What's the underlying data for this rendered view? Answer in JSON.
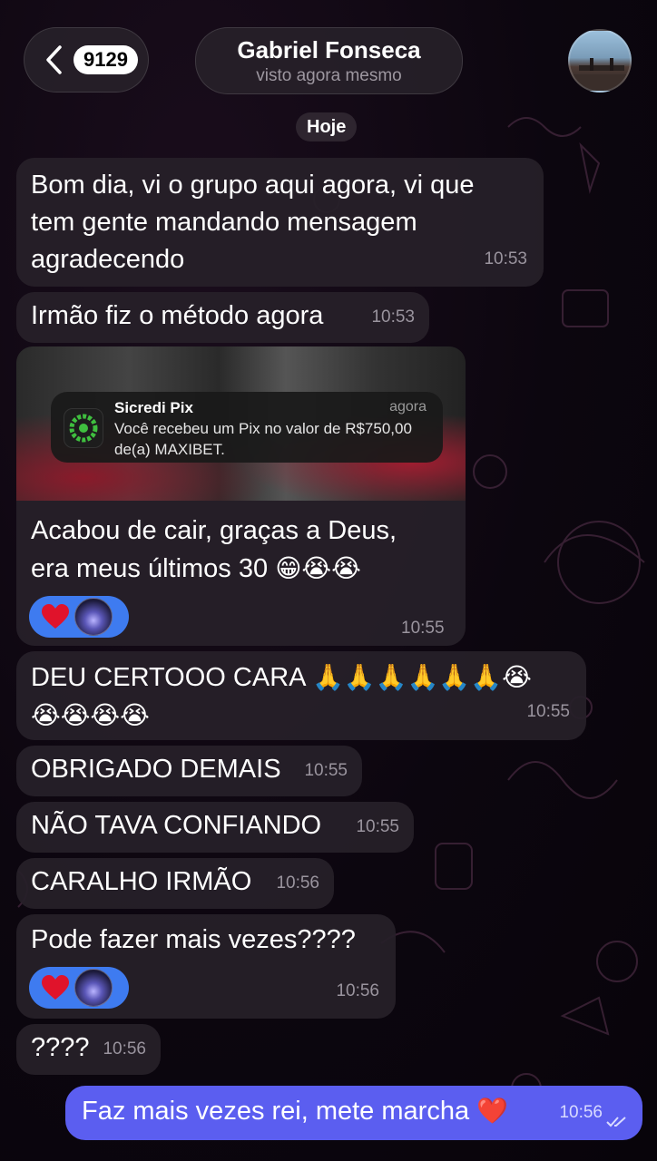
{
  "header": {
    "unread_count": "9129",
    "contact_name": "Gabriel Fonseca",
    "contact_status": "visto agora mesmo"
  },
  "date_divider": "Hoje",
  "messages": [
    {
      "lines": [
        "Bom dia, vi o grupo aqui agora, vi que",
        "tem gente mandando mensagem",
        "agradecendo"
      ],
      "time": "10:53"
    },
    {
      "text": "Irmão fiz o método agora",
      "time": "10:53"
    },
    {
      "notification": {
        "app": "Sicredi Pix",
        "when": "agora",
        "line1": "Você recebeu um Pix no valor de R$750,00",
        "line2": "de(a) MAXIBET."
      },
      "lines": [
        "Acabou de cair, graças a Deus,",
        "era meus últimos 30"
      ],
      "emojis": "😁😭😭",
      "time": "10:55"
    },
    {
      "text": "DEU CERTOOO CARA",
      "emojis1": "🙏🙏🙏🙏🙏🙏😭",
      "emojis2": "😭😭😭😭",
      "time": "10:55"
    },
    {
      "text": "OBRIGADO DEMAIS",
      "time": "10:55"
    },
    {
      "text": "NÃO TAVA CONFIANDO",
      "time": "10:55"
    },
    {
      "text": "CARALHO IRMÃO",
      "time": "10:56"
    },
    {
      "text": "Pode fazer mais vezes????",
      "time": "10:56"
    },
    {
      "text": "????",
      "time": "10:56"
    }
  ],
  "outgoing": {
    "text": "Faz mais vezes rei, mete marcha",
    "emoji": "❤️",
    "time": "10:56"
  },
  "colors": {
    "outgoing_bubble": "#5b5ef0",
    "reaction_pill": "#3e7bf0",
    "incoming_bubble": "#262028"
  }
}
